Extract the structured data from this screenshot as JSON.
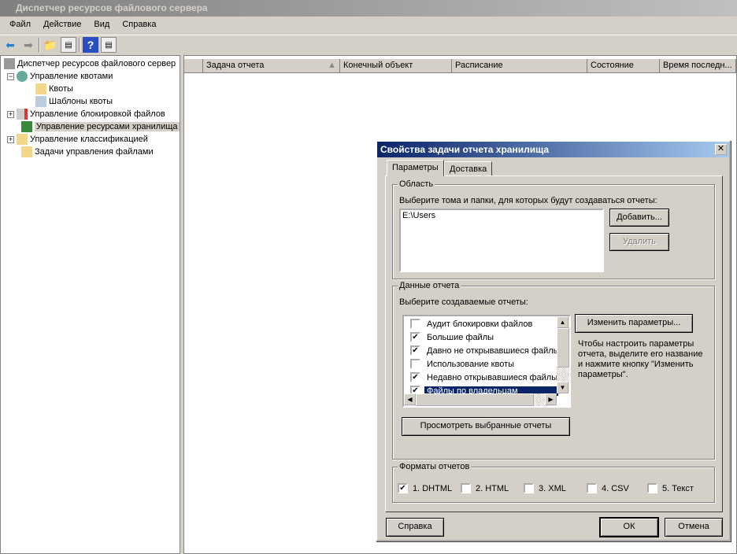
{
  "window": {
    "title": "Диспетчер ресурсов файлового сервера"
  },
  "menu": [
    "Файл",
    "Действие",
    "Вид",
    "Справка"
  ],
  "tree": {
    "root": "Диспетчер ресурсов файлового сервер",
    "items": [
      "Управление квотами",
      "Квоты",
      "Шаблоны квоты",
      "Управление блокировкой файлов",
      "Управление ресурсами хранилища",
      "Управление классификацией",
      "Задачи управления файлами"
    ]
  },
  "columns": [
    "Задача отчета",
    "Конечный объект",
    "Расписание",
    "Состояние",
    "Время последн..."
  ],
  "dialog": {
    "title": "Свойства задачи отчета хранилища",
    "tabs": [
      "Параметры",
      "Доставка"
    ],
    "scope": {
      "label": "Область",
      "prompt": "Выберите тома и папки, для которых будут создаваться отчеты:",
      "paths": [
        "E:\\Users"
      ],
      "add": "Добавить...",
      "remove": "Удалить"
    },
    "report": {
      "label": "Данные отчета",
      "prompt": "Выберите создаваемые отчеты:",
      "items": [
        {
          "label": "Аудит блокировки файлов",
          "checked": false
        },
        {
          "label": "Большие файлы",
          "checked": true
        },
        {
          "label": "Давно не открывавшиеся файлы",
          "checked": true
        },
        {
          "label": "Использование квоты",
          "checked": false
        },
        {
          "label": "Недавно открывавшиеся файлы",
          "checked": true
        },
        {
          "label": "Файлы по владельцам",
          "checked": true,
          "selected": true
        }
      ],
      "edit": "Изменить параметры...",
      "hint": "Чтобы настроить параметры отчета, выделите его название и нажмите кнопку \"Изменить параметры\".",
      "view": "Просмотреть выбранные отчеты"
    },
    "formats": {
      "label": "Форматы отчетов",
      "items": [
        {
          "label": "1. DHTML",
          "checked": true
        },
        {
          "label": "2. HTML",
          "checked": false
        },
        {
          "label": "3.  XML",
          "checked": false
        },
        {
          "label": "4. CSV",
          "checked": false
        },
        {
          "label": "5. Текст",
          "checked": false
        }
      ]
    },
    "help": "Справка",
    "ok": "ОК",
    "cancel": "Отмена"
  }
}
